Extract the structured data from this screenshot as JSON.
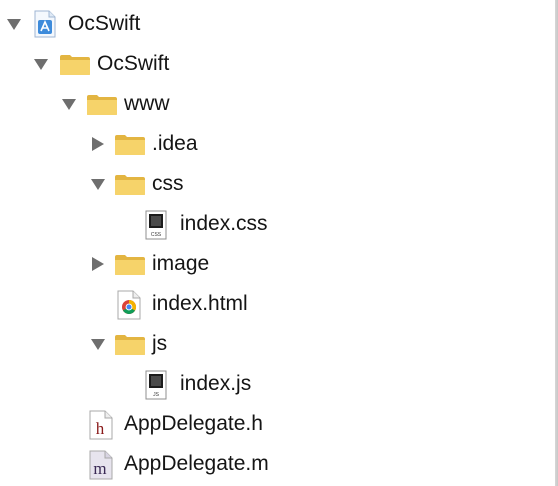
{
  "tree": {
    "items": [
      {
        "label": "OcSwift",
        "icon": "xcode-project-icon",
        "disclosure": "expanded"
      },
      {
        "label": "OcSwift",
        "icon": "folder-icon",
        "disclosure": "expanded"
      },
      {
        "label": "www",
        "icon": "folder-icon",
        "disclosure": "expanded"
      },
      {
        "label": ".idea",
        "icon": "folder-icon",
        "disclosure": "collapsed"
      },
      {
        "label": "css",
        "icon": "folder-icon",
        "disclosure": "expanded"
      },
      {
        "label": "index.css",
        "icon": "css-file-icon",
        "disclosure": "none",
        "badge": "CSS"
      },
      {
        "label": "image",
        "icon": "folder-icon",
        "disclosure": "collapsed"
      },
      {
        "label": "index.html",
        "icon": "chrome-html-file-icon",
        "disclosure": "none"
      },
      {
        "label": "js",
        "icon": "folder-icon",
        "disclosure": "expanded"
      },
      {
        "label": "index.js",
        "icon": "js-file-icon",
        "disclosure": "none",
        "badge": "JS"
      },
      {
        "label": "AppDelegate.h",
        "icon": "header-file-icon",
        "disclosure": "none",
        "glyph": "h"
      },
      {
        "label": "AppDelegate.m",
        "icon": "objc-file-icon",
        "disclosure": "none",
        "glyph": "m"
      }
    ]
  },
  "colors": {
    "folder": "#f6d36a",
    "folder_dark": "#e3b541",
    "triangle": "#6e6e6e",
    "header_glyph": "#8a1a1a",
    "objc_glyph": "#3a2a55"
  }
}
